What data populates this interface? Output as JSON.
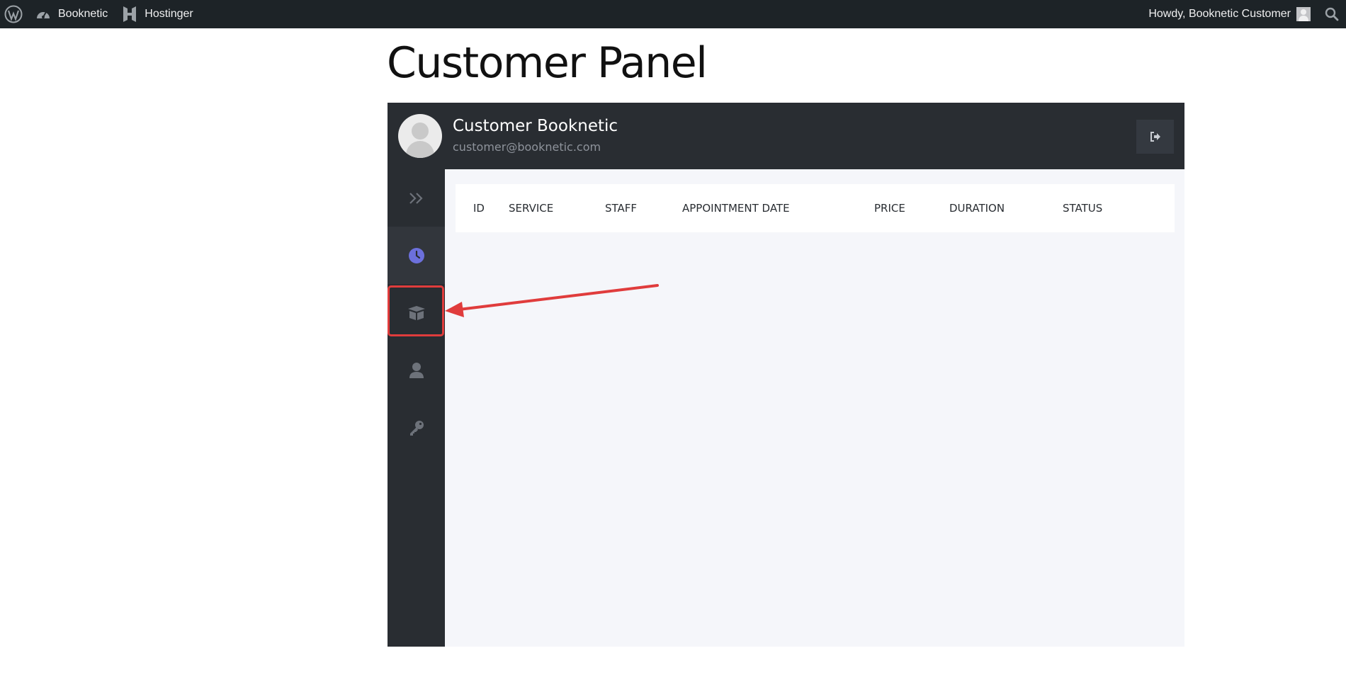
{
  "adminbar": {
    "site_label": "Booknetic",
    "hosting_label": "Hostinger",
    "greeting": "Howdy, Booknetic Customer",
    "icons": [
      "wordpress-icon",
      "dashboard-icon",
      "hostinger-icon",
      "avatar",
      "search-icon"
    ]
  },
  "page": {
    "title": "Customer Panel"
  },
  "panel": {
    "customer_name": "Customer Booknetic",
    "customer_email": "customer@booknetic.com",
    "sidebar_icons": [
      "expand-icon",
      "clock-icon",
      "box-icon",
      "user-icon",
      "key-icon"
    ],
    "active_item": "appointments",
    "table": {
      "columns": [
        "ID",
        "SERVICE",
        "STAFF",
        "APPOINTMENT DATE",
        "PRICE",
        "DURATION",
        "STATUS"
      ]
    }
  },
  "colors": {
    "adminbar_bg": "#1d2327",
    "panel_dark": "#292d32",
    "panel_bg": "#f5f6fa",
    "accent": "#6c70dc",
    "annotation": "#e03c3c"
  }
}
